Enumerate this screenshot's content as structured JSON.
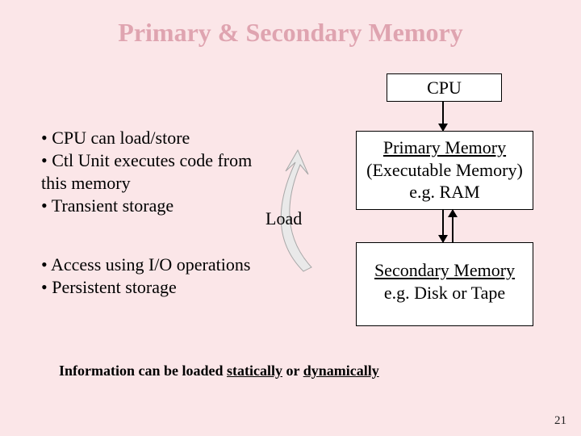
{
  "title": "Primary & Secondary Memory",
  "cpu_label": "CPU",
  "primary": {
    "line1": "Primary Memory",
    "line2": "(Executable Memory)",
    "line3": "e.g. RAM"
  },
  "secondary": {
    "line1": "Secondary Memory",
    "line2": "e.g. Disk or Tape"
  },
  "bullets_top": {
    "b1": "• CPU can load/store",
    "b2": "• Ctl Unit executes code from this memory",
    "b3": "• Transient storage"
  },
  "bullets_bottom": {
    "b1": "• Access using I/O operations",
    "b2": "• Persistent storage"
  },
  "load_label": "Load",
  "footnote": {
    "prefix": "Information can be loaded ",
    "word1": "statically",
    "middle": " or ",
    "word2": "dynamically"
  },
  "page_number": "21"
}
